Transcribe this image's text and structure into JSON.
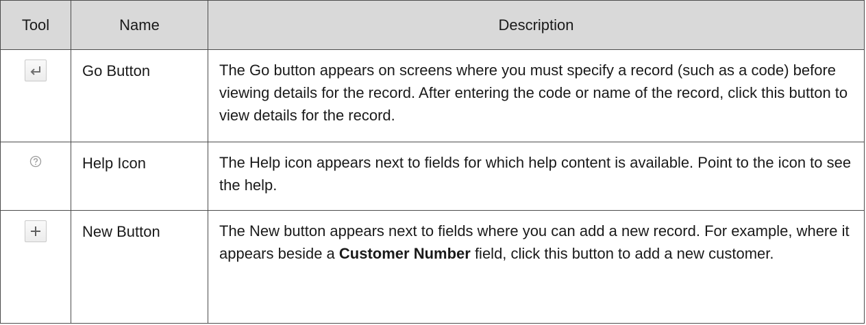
{
  "table": {
    "headers": {
      "tool": "Tool",
      "name": "Name",
      "description": "Description"
    },
    "rows": [
      {
        "icon": "go-arrow-icon",
        "name": "Go Button",
        "description": "The Go button appears on screens where you must specify a record (such as a code) before viewing details for the record. After entering the code or name of the record, click this button to view details for the record."
      },
      {
        "icon": "question-circle-icon",
        "name": "Help Icon",
        "description": "The Help icon appears next to fields for which help content is available. Point to the icon to see the help."
      },
      {
        "icon": "plus-icon",
        "name": "New Button",
        "description_before": "The New button appears next to fields where you can add a new record. For example, where it appears beside a ",
        "description_term": "Customer Number",
        "description_after": " field, click this button to add a new customer."
      }
    ]
  },
  "colors": {
    "header_background": "#d9d9d9",
    "border": "#4a4a4a",
    "text": "#1a1a1a",
    "icon_gray": "#7a7a7a"
  }
}
